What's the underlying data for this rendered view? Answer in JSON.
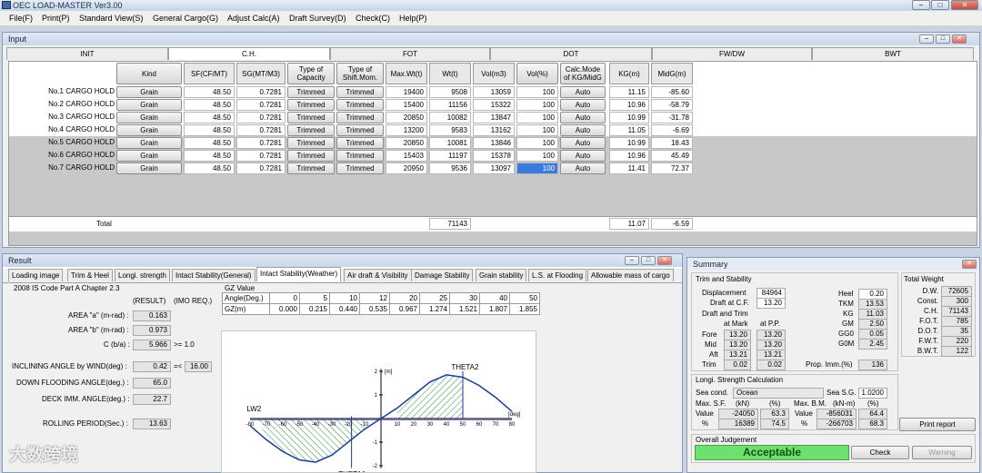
{
  "app": {
    "title": "OEC LOAD-MASTER Ver3.00"
  },
  "menu": [
    "File(F)",
    "Print(P)",
    "Standard View(S)",
    "General Cargo(G)",
    "Adjust Calc(A)",
    "Draft Survey(D)",
    "Check(C)",
    "Help(P)"
  ],
  "input": {
    "title": "Input",
    "tabs": [
      "INIT",
      "C.H.",
      "FOT",
      "DOT",
      "FW/DW",
      "BWT"
    ],
    "active_tab": "C.H.",
    "columns": [
      "Kind",
      "SF(CF/MT)",
      "SG(MT/M3)",
      "Type of\nCapacity",
      "Type of\nShift.Mom.",
      "Max.Wt(t)",
      "Wt(t)",
      "Vol(m3)",
      "Vol(%)",
      "Calc.Mode\nof KG/MidG",
      "KG(m)",
      "MidG(m)"
    ],
    "rows": [
      {
        "name": "No.1 CARGO HOLD",
        "kind": "Grain",
        "sf": "48.50",
        "sg": "0.7281",
        "cap": "Trimmed",
        "shift": "Trimmed",
        "maxwt": "19400",
        "wt": "9508",
        "vol": "13059",
        "volp": "100",
        "mode": "Auto",
        "kg": "11.15",
        "midg": "-85.60"
      },
      {
        "name": "No.2 CARGO HOLD",
        "kind": "Grain",
        "sf": "48.50",
        "sg": "0.7281",
        "cap": "Trimmed",
        "shift": "Trimmed",
        "maxwt": "15400",
        "wt": "11156",
        "vol": "15322",
        "volp": "100",
        "mode": "Auto",
        "kg": "10.96",
        "midg": "-58.79"
      },
      {
        "name": "No.3 CARGO HOLD",
        "kind": "Grain",
        "sf": "48.50",
        "sg": "0.7281",
        "cap": "Trimmed",
        "shift": "Trimmed",
        "maxwt": "20850",
        "wt": "10082",
        "vol": "13847",
        "volp": "100",
        "mode": "Auto",
        "kg": "10.99",
        "midg": "-31.78"
      },
      {
        "name": "No.4 CARGO HOLD",
        "kind": "Grain",
        "sf": "48.50",
        "sg": "0.7281",
        "cap": "Trimmed",
        "shift": "Trimmed",
        "maxwt": "13200",
        "wt": "9583",
        "vol": "13162",
        "volp": "100",
        "mode": "Auto",
        "kg": "11.05",
        "midg": "-6.69"
      },
      {
        "name": "No.5 CARGO HOLD",
        "kind": "Grain",
        "sf": "48.50",
        "sg": "0.7281",
        "cap": "Trimmed",
        "shift": "Trimmed",
        "maxwt": "20850",
        "wt": "10081",
        "vol": "13846",
        "volp": "100",
        "mode": "Auto",
        "kg": "10.99",
        "midg": "18.43"
      },
      {
        "name": "No.6 CARGO HOLD",
        "kind": "Grain",
        "sf": "48.50",
        "sg": "0.7281",
        "cap": "Trimmed",
        "shift": "Trimmed",
        "maxwt": "15403",
        "wt": "11197",
        "vol": "15378",
        "volp": "100",
        "mode": "Auto",
        "kg": "10.96",
        "midg": "45.49"
      },
      {
        "name": "No.7 CARGO HOLD",
        "kind": "Grain",
        "sf": "48.50",
        "sg": "0.7281",
        "cap": "Trimmed",
        "shift": "Trimmed",
        "maxwt": "20950",
        "wt": "9536",
        "vol": "13097",
        "volp": "100",
        "mode": "Auto",
        "kg": "11.41",
        "midg": "72.37"
      }
    ],
    "total": {
      "label": "Total",
      "wt": "71143",
      "kg": "11.07",
      "midg": "-6.59"
    }
  },
  "result": {
    "title": "Result",
    "tabs": [
      "Loading image",
      "Trim & Heel",
      "Longi. strength",
      "Intact Stability(General)",
      "Intact Stability(Weather)",
      "Air draft & Visibility",
      "Damage Stability",
      "Grain stability",
      "L.S. at Flooding",
      "Allowable mass of cargo"
    ],
    "active_tab": "Intact Stability(Weather)",
    "code": "2008 IS Code Part A Chapter 2.3",
    "result_hdr": "(RESULT)",
    "imo_hdr": "(IMO REQ.)",
    "area_a_label": "AREA \"a\" (m-rad) :",
    "area_a": "0.163",
    "area_b_label": "AREA \"b\" (m-rad) :",
    "area_b": "0.973",
    "c_label": "C (b/a) :",
    "c": "5.966",
    "c_req": ">= 1.0",
    "incl_label": "INCLINING ANGLE by WIND(deg) :",
    "incl": "0.42",
    "incl_op": "=<",
    "incl_req": "16.00",
    "flood_label": "DOWN FLOODING ANGLE(deg.) :",
    "flood": "65.0",
    "deck_label": "DECK IMM. ANGLE(deg.) :",
    "deck": "22.7",
    "roll_label": "ROLLING PERIOD(Sec.) :",
    "roll": "13.63",
    "gz_title": "GZ Value",
    "gz_angle_label": "Angle(Deg.)",
    "gz_label": "GZ(m)",
    "gz_angles": [
      "0",
      "5",
      "10",
      "12",
      "20",
      "25",
      "30",
      "40",
      "50"
    ],
    "gz_values": [
      "0.000",
      "0.215",
      "0.440",
      "0.535",
      "0.967",
      "1.274",
      "1.521",
      "1.807",
      "1.855"
    ]
  },
  "chart_data": {
    "type": "line",
    "xlim": [
      -80,
      80
    ],
    "ylim": [
      -2,
      2
    ],
    "ylabel": "[m]",
    "xlabel": "[deg]",
    "x_ticks": [
      "-80",
      "-70",
      "-60",
      "-50",
      "-40",
      "-30",
      "-20",
      "-10",
      "10",
      "20",
      "30",
      "40",
      "50",
      "60",
      "70",
      "80"
    ],
    "y_ticks": [
      "2",
      "1",
      "-1",
      "-2"
    ],
    "x": [
      -80,
      -70,
      -60,
      -50,
      -40,
      -30,
      -20,
      -10,
      0,
      10,
      20,
      30,
      40,
      50,
      60,
      70,
      80
    ],
    "series": [
      {
        "values": [
          -0.3,
          -0.9,
          -1.4,
          -1.75,
          -1.85,
          -1.55,
          -1.0,
          -0.45,
          0.0,
          0.45,
          1.0,
          1.55,
          1.85,
          1.75,
          1.4,
          0.9,
          0.3
        ]
      }
    ],
    "annotations": [
      "LW2",
      "THETA2",
      "THETA1"
    ]
  },
  "summary": {
    "title": "Summary",
    "trim_title": "Trim and Stability",
    "displacement_label": "Displacement",
    "displacement": "84964",
    "draft_cf_label": "Draft at C.F.",
    "draft_cf": "13.20",
    "dt_title": "Draft and Trim",
    "at_mark": "at Mark",
    "at_pp": "at P.P.",
    "fore_label": "Fore",
    "fore_mark": "13.20",
    "fore_pp": "13.20",
    "mid_label": "Mid",
    "mid_mark": "13.20",
    "mid_pp": "13.20",
    "aft_label": "Aft",
    "aft_mark": "13.21",
    "aft_pp": "13.21",
    "trim_label": "Trim",
    "trim_mark": "0.02",
    "trim_pp": "0.02",
    "heel_label": "Heel",
    "heel": "0.20",
    "tkm_label": "TKM",
    "tkm": "13.53",
    "kg_label": "KG",
    "kg": "11.03",
    "gm_label": "GM",
    "gm": "2.50",
    "gg0_label": "GG0",
    "gg0": "0.05",
    "g0m_label": "G0M",
    "g0m": "2.45",
    "prop_label": "Prop. Imm.(%)",
    "prop": "136",
    "tw_title": "Total Weight",
    "tw": [
      {
        "l": "D.W.",
        "v": "72605"
      },
      {
        "l": "Const.",
        "v": "300"
      },
      {
        "l": "C.H.",
        "v": "71143"
      },
      {
        "l": "F.O.T.",
        "v": "785"
      },
      {
        "l": "D.O.T.",
        "v": "35"
      },
      {
        "l": "F.W.T.",
        "v": "220"
      },
      {
        "l": "B.W.T.",
        "v": "122"
      }
    ],
    "longi_title": "Longi. Strength Calculation",
    "sea_cond_label": "Sea cond.",
    "sea_cond": "Ocean",
    "sea_sg_label": "Sea S.G.",
    "sea_sg": "1.0200",
    "maxsf_label": "Max. S.F.",
    "kn": "(kN)",
    "pct": "(%)",
    "maxbm_label": "Max. B.M.",
    "knm": "(kN-m)",
    "value_label": "Value",
    "pct_label": "%",
    "sf_value": "-24050",
    "sf_value_pct": "63.3",
    "sf_pct": "16389",
    "sf_pct_pct": "74.5",
    "bm_value": "-856031",
    "bm_value_pct": "64.4",
    "bm_pct": "-266703",
    "bm_pct_pct": "68.3",
    "print_report": "Print report",
    "overall_title": "Overall Judgement",
    "judgement": "Acceptable",
    "check": "Check",
    "warning": "Warning"
  },
  "watermark": "大数跨境"
}
